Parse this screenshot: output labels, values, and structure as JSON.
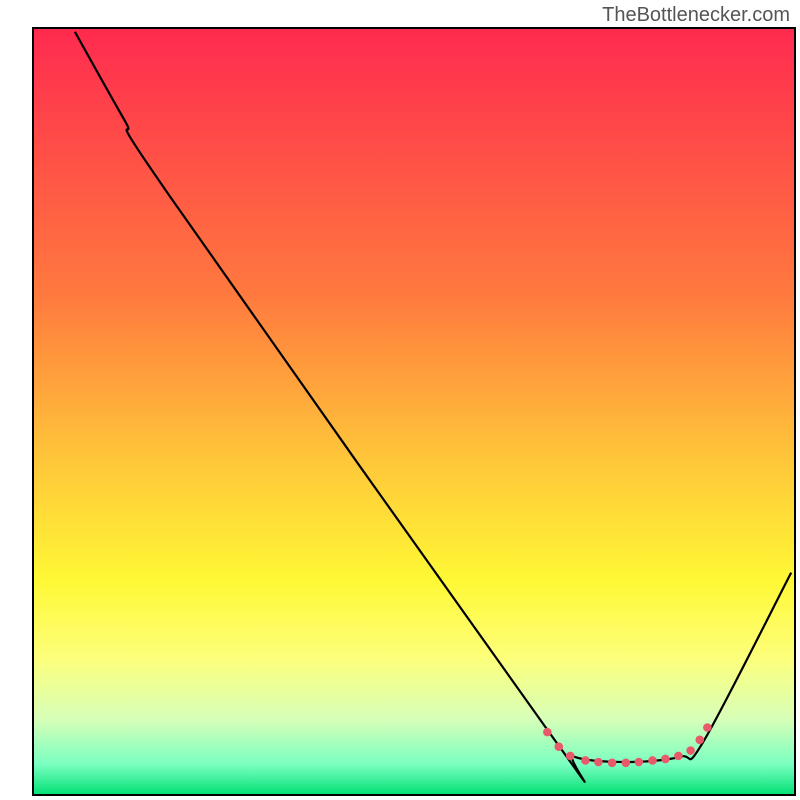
{
  "watermark": "TheBottlenecker.com",
  "chart_data": {
    "type": "line",
    "title": "",
    "xlabel": "",
    "ylabel": "",
    "xlim": [
      0,
      100
    ],
    "ylim": [
      0,
      100
    ],
    "gradient_stops": [
      {
        "offset": 0,
        "color": "#ff2a4f"
      },
      {
        "offset": 35,
        "color": "#ff7a3e"
      },
      {
        "offset": 55,
        "color": "#ffc23a"
      },
      {
        "offset": 72,
        "color": "#fff835"
      },
      {
        "offset": 82,
        "color": "#fdff7a"
      },
      {
        "offset": 90,
        "color": "#d8ffb8"
      },
      {
        "offset": 96,
        "color": "#7affc0"
      },
      {
        "offset": 100,
        "color": "#00e074"
      }
    ],
    "series": [
      {
        "name": "bottleneck-curve",
        "type": "smooth-line",
        "color": "#000000",
        "width": 2.2,
        "points": [
          {
            "x": 5.5,
            "y": 99.5
          },
          {
            "x": 12,
            "y": 88
          },
          {
            "x": 18,
            "y": 78
          },
          {
            "x": 68,
            "y": 7.8
          },
          {
            "x": 71,
            "y": 5
          },
          {
            "x": 78,
            "y": 4.3
          },
          {
            "x": 85,
            "y": 5
          },
          {
            "x": 88,
            "y": 7
          },
          {
            "x": 99.5,
            "y": 29
          }
        ]
      },
      {
        "name": "optimal-zone-markers",
        "type": "dotted-overlay",
        "color": "#e85a6a",
        "dot_radius": 4.3,
        "points": [
          {
            "x": 67.5,
            "y": 8.2
          },
          {
            "x": 69,
            "y": 6.3
          },
          {
            "x": 70.5,
            "y": 5.1
          },
          {
            "x": 72.5,
            "y": 4.5
          },
          {
            "x": 74.2,
            "y": 4.3
          },
          {
            "x": 76,
            "y": 4.2
          },
          {
            "x": 77.8,
            "y": 4.2
          },
          {
            "x": 79.5,
            "y": 4.3
          },
          {
            "x": 81.3,
            "y": 4.5
          },
          {
            "x": 83,
            "y": 4.7
          },
          {
            "x": 84.7,
            "y": 5.1
          },
          {
            "x": 86.3,
            "y": 5.8
          },
          {
            "x": 87.5,
            "y": 7.2
          },
          {
            "x": 88.5,
            "y": 8.8
          }
        ]
      }
    ]
  }
}
